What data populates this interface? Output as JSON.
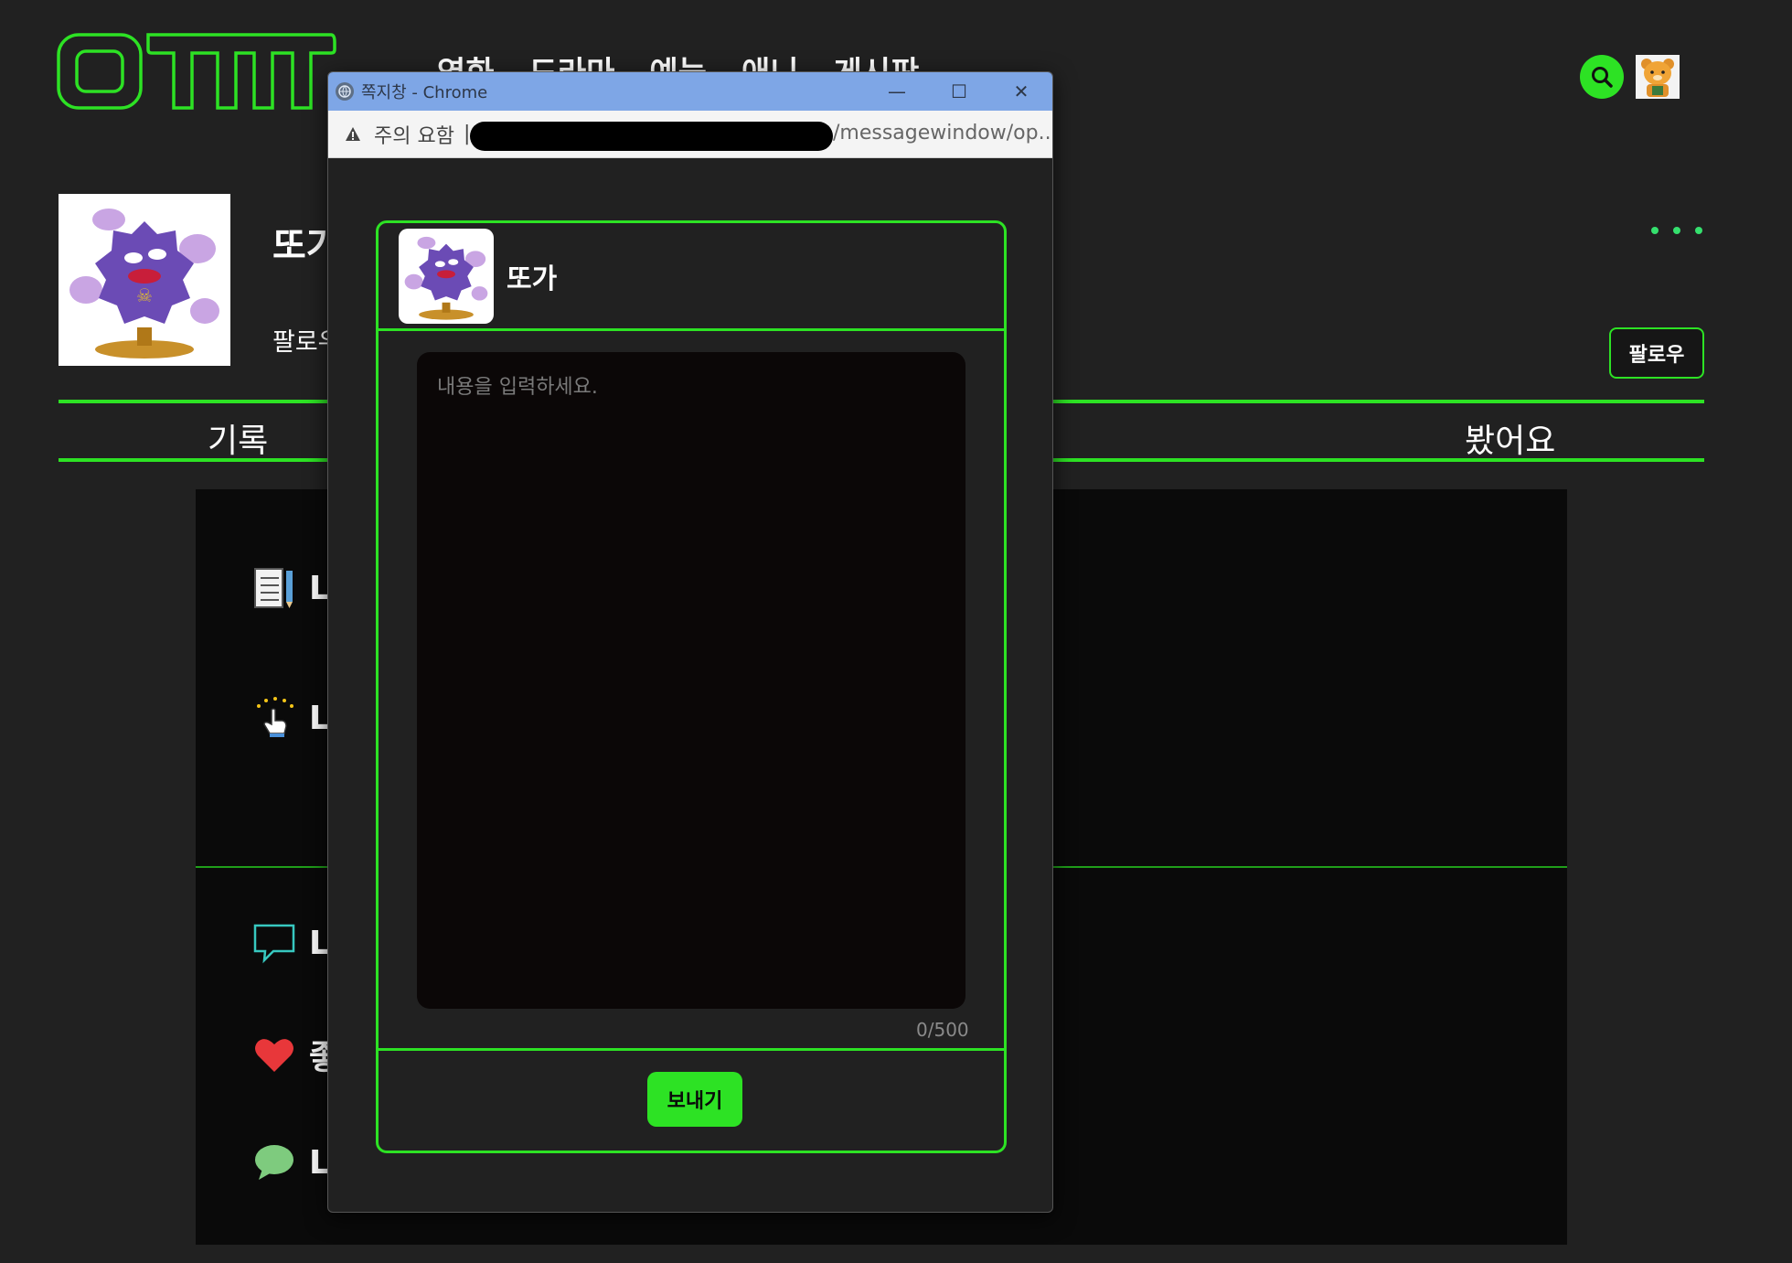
{
  "header": {
    "logo_text": "OTTT",
    "nav": [
      "영화",
      "드라마",
      "예능",
      "애니",
      "게시판"
    ]
  },
  "profile": {
    "name": "또가",
    "follow_label": "팔로우",
    "follow_button": "팔로우"
  },
  "tabs": {
    "left": "기록",
    "right": "봤어요"
  },
  "content_rows": [
    {
      "icon": "notebook-pencil-icon",
      "text": "L"
    },
    {
      "icon": "hand-pointer-sparkle-icon",
      "text": "L"
    },
    {
      "icon": "chat-outline-icon",
      "text": "L"
    },
    {
      "icon": "heart-icon",
      "text": "좋"
    },
    {
      "icon": "speech-bubble-icon",
      "text": "L"
    }
  ],
  "popup": {
    "window_title": "쪽지창 - Chrome",
    "controls": {
      "minimize": "—",
      "maximize": "☐",
      "close": "✕"
    },
    "address": {
      "warning": "주의 요함",
      "separator": "|",
      "url_tail": "/messagewindow/op..."
    },
    "recipient": "또가",
    "placeholder": "내용을 입력하세요.",
    "counter": "0/500",
    "send_button": "보내기"
  },
  "colors": {
    "accent": "#2de224",
    "background": "#212121",
    "panel": "#0a0a0a"
  }
}
